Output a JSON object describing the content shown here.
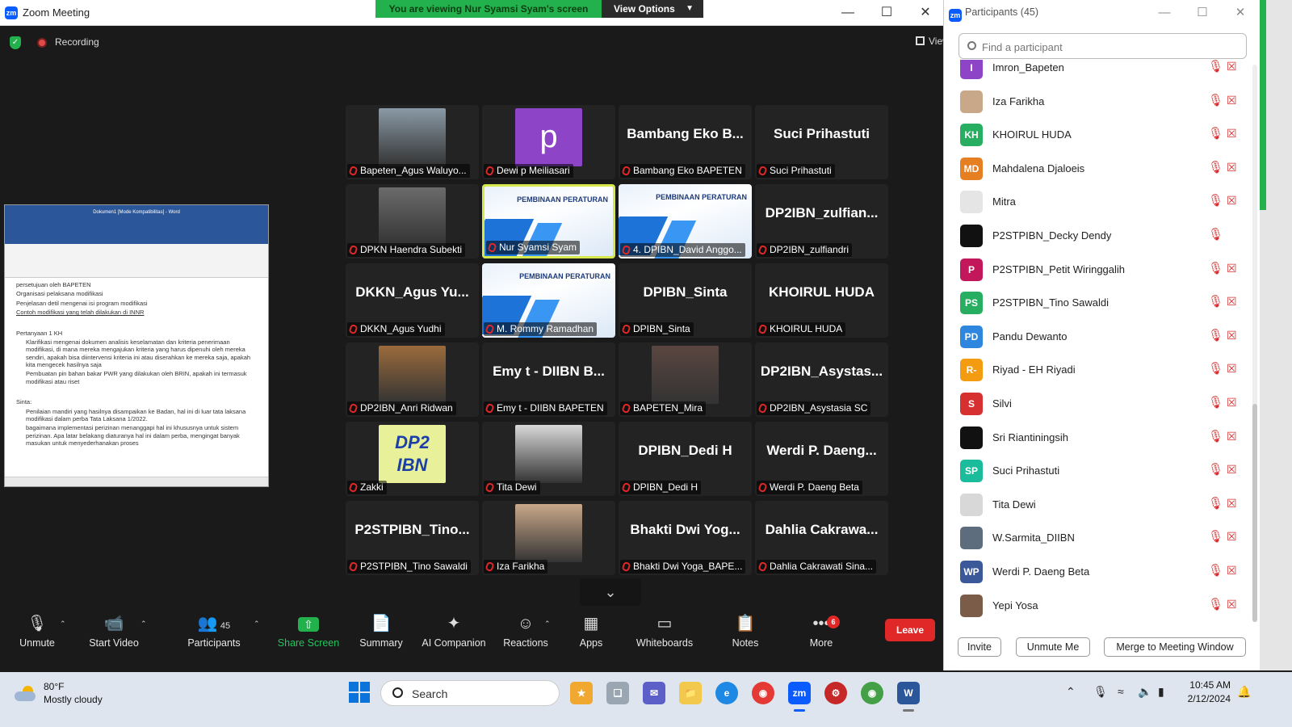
{
  "window": {
    "title": "Zoom Meeting",
    "banner": "You are viewing Nur Syamsi Syam's screen",
    "view_options": "View Options",
    "recording": "Recording",
    "view_label": "View"
  },
  "shared_doc": {
    "title": "Dokumen1 [Mode Kompatibilitas] - Word",
    "lines_top": [
      "persetujuan oleh BAPETEN",
      "Organisasi pelaksana modifikasi",
      "Penjelasan detil mengenai isi program modifikasi",
      "Contoh modifikasi yang telah dilakukan di INNR"
    ],
    "q_heading": "Pertanyaan 1 KH",
    "q_items": [
      "Klarifikasi mengenai dokumen analisis keselamatan dan kriteria penerimaan modifikasi, di mana mereka mengajukan kriteria yang harus dipenuhi oleh mereka sendiri, apakah bisa diintervensi kriteria ini atau diserahkan ke mereka saja, apakah kita mengecek hasilnya saja",
      "Pembuatan pin bahan bakar PWR yang dilakukan oleh BRIN, apakah ini termasuk modifikasi atau riset"
    ],
    "sinta_heading": "Sinta:",
    "sinta_items": [
      "Penilaian mandiri yang hasilnya disampaikan ke Badan, hal ini di luar tata laksana modifikasi dalam perba Tata Laksana 1/2022.",
      "bagaimana implementasi perizinan menanggapi hal ini khususnya untuk sistem perizinan. Apa latar belakang diaturanya hal ini dalam perba, mengingat banyak masukan untuk menyederhanakan proses"
    ]
  },
  "tiles": [
    {
      "big": "",
      "caption": "Bapeten_Agus Waluyo...",
      "kind": "photo",
      "color": "#8a9aa6"
    },
    {
      "big": "p",
      "caption": "Dewi p Meiliasari",
      "kind": "letter",
      "color": "#8e44c7"
    },
    {
      "big": "Bambang Eko B...",
      "caption": "Bambang Eko BAPETEN",
      "kind": "name",
      "color": ""
    },
    {
      "big": "Suci Prihastuti",
      "caption": "Suci Prihastuti",
      "kind": "name",
      "color": ""
    },
    {
      "big": "",
      "caption": "DPKN Haendra Subekti",
      "kind": "photo",
      "color": "#6b6b6b"
    },
    {
      "big": "PEMBINAAN PERATURAN",
      "caption": "Nur Syamsi Syam",
      "kind": "slide",
      "color": "",
      "active": true
    },
    {
      "big": "PEMBINAAN PERATURAN",
      "caption": "4. DPIBN_David Anggo...",
      "kind": "slide",
      "color": ""
    },
    {
      "big": "DP2IBN_zulfian...",
      "caption": "DP2IBN_zulfiandri",
      "kind": "name",
      "color": ""
    },
    {
      "big": "DKKN_Agus Yu...",
      "caption": "DKKN_Agus Yudhi",
      "kind": "name",
      "color": ""
    },
    {
      "big": "PEMBINAAN PERATURAN",
      "caption": "M. Rommy Ramadhan",
      "kind": "slide",
      "color": ""
    },
    {
      "big": "DPIBN_Sinta",
      "caption": "DPIBN_Sinta",
      "kind": "name",
      "color": ""
    },
    {
      "big": "KHOIRUL HUDA",
      "caption": "KHOIRUL HUDA",
      "kind": "name",
      "color": ""
    },
    {
      "big": "",
      "caption": "DP2IBN_Anri Ridwan",
      "kind": "photo",
      "color": "#9b6b3c"
    },
    {
      "big": "Emy t - DIIBN B...",
      "caption": "Emy t - DIIBN BAPETEN",
      "kind": "name",
      "color": ""
    },
    {
      "big": "",
      "caption": "BAPETEN_Mira",
      "kind": "photo",
      "color": "#5a4640"
    },
    {
      "big": "DP2IBN_Asystas...",
      "caption": "DP2IBN_Asystasia SC",
      "kind": "name",
      "color": ""
    },
    {
      "big": "DP2 IBN",
      "caption": "Zakki",
      "kind": "logo",
      "color": "#e8f09a"
    },
    {
      "big": "",
      "caption": "Tita Dewi",
      "kind": "photo",
      "color": "#d8d8d8"
    },
    {
      "big": "DPIBN_Dedi H",
      "caption": "DPIBN_Dedi H",
      "kind": "name",
      "color": ""
    },
    {
      "big": "Werdi P. Daeng...",
      "caption": "Werdi P. Daeng Beta",
      "kind": "name",
      "color": ""
    },
    {
      "big": "P2STPIBN_Tino...",
      "caption": "P2STPIBN_Tino Sawaldi",
      "kind": "name",
      "color": ""
    },
    {
      "big": "",
      "caption": "Iza Farikha",
      "kind": "photo",
      "color": "#c9a88a"
    },
    {
      "big": "Bhakti Dwi Yog...",
      "caption": "Bhakti Dwi Yoga_BAPE...",
      "kind": "name",
      "color": ""
    },
    {
      "big": "Dahlia Cakrawa...",
      "caption": "Dahlia Cakrawati Sina...",
      "kind": "name",
      "color": ""
    }
  ],
  "toolbar": {
    "unmute": "Unmute",
    "start_video": "Start Video",
    "participants": "Participants",
    "participants_count": "45",
    "share_screen": "Share Screen",
    "summary": "Summary",
    "ai_companion": "AI Companion",
    "reactions": "Reactions",
    "apps": "Apps",
    "whiteboards": "Whiteboards",
    "notes": "Notes",
    "more": "More",
    "more_badge": "6",
    "leave": "Leave"
  },
  "panel": {
    "title": "Participants (45)",
    "search_placeholder": "Find a participant",
    "participants": [
      {
        "name": "Imron_Bapeten",
        "initials": "I",
        "color": "#8e44c7",
        "video_icon": true
      },
      {
        "name": "Iza Farikha",
        "initials": "",
        "color": "#c9a88a",
        "video_icon": true
      },
      {
        "name": "KHOIRUL HUDA",
        "initials": "KH",
        "color": "#27ae60",
        "video_icon": true
      },
      {
        "name": "Mahdalena Djaloeis",
        "initials": "MD",
        "color": "#e67e22",
        "video_icon": true
      },
      {
        "name": "Mitra",
        "initials": "",
        "color": "#e5e5e5",
        "video_icon": true
      },
      {
        "name": "P2STPIBN_Decky Dendy",
        "initials": "",
        "color": "#111111",
        "video_icon": false
      },
      {
        "name": "P2STPIBN_Petit Wiringgalih",
        "initials": "P",
        "color": "#c2185b",
        "video_icon": true
      },
      {
        "name": "P2STPIBN_Tino Sawaldi",
        "initials": "PS",
        "color": "#27ae60",
        "video_icon": true
      },
      {
        "name": "Pandu Dewanto",
        "initials": "PD",
        "color": "#2e86de",
        "video_icon": true
      },
      {
        "name": "Riyad - EH Riyadi",
        "initials": "R-",
        "color": "#f39c12",
        "video_icon": true
      },
      {
        "name": "Silvi",
        "initials": "S",
        "color": "#d63031",
        "video_icon": true
      },
      {
        "name": "Sri Riantiningsih",
        "initials": "",
        "color": "#111111",
        "video_icon": true
      },
      {
        "name": "Suci Prihastuti",
        "initials": "SP",
        "color": "#1abc9c",
        "video_icon": true
      },
      {
        "name": "Tita Dewi",
        "initials": "",
        "color": "#d8d8d8",
        "video_icon": true
      },
      {
        "name": "W.Sarmita_DIIBN",
        "initials": "",
        "color": "#5d6d7e",
        "video_icon": true
      },
      {
        "name": "Werdi P. Daeng Beta",
        "initials": "WP",
        "color": "#3b5998",
        "video_icon": true
      },
      {
        "name": "Yepi Yosa",
        "initials": "",
        "color": "#7a5c48",
        "video_icon": true
      }
    ],
    "invite": "Invite",
    "unmute_me": "Unmute Me",
    "merge": "Merge to Meeting Window"
  },
  "taskbar": {
    "temp": "80°F",
    "weather": "Mostly cloudy",
    "search": "Search",
    "time": "10:45 AM",
    "date": "2/12/2024"
  }
}
